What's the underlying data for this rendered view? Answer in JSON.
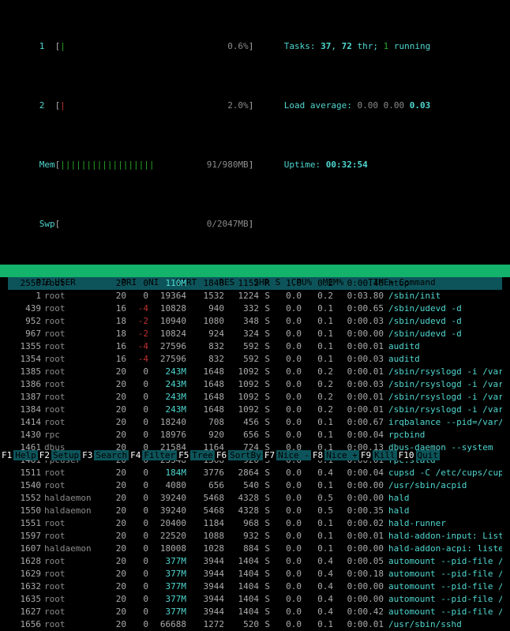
{
  "header": {
    "cpu1": {
      "label": "1",
      "bar": "|",
      "value": "0.6%"
    },
    "cpu2": {
      "label": "2",
      "bar": "|",
      "value": "2.0%"
    },
    "mem": {
      "label": "Mem",
      "bar": "||||||||||||||||||",
      "value": "91/980MB"
    },
    "swp": {
      "label": "Swp",
      "bar": "",
      "value": "0/2047MB"
    },
    "tasks": {
      "prefix": "Tasks: ",
      "total": "37",
      "sep1": ", ",
      "thr": "72",
      "thr_lbl": " thr; ",
      "running": "1",
      "running_lbl": " running"
    },
    "load": {
      "prefix": "Load average: ",
      "v1": "0.00",
      "v2": "0.00",
      "v3": "0.03"
    },
    "uptime": {
      "prefix": "Uptime: ",
      "value": "00:32:54"
    }
  },
  "columns": {
    "pid": "PID",
    "user": "USER",
    "pri": "PRI",
    "ni": "NI",
    "virt": "VIRT",
    "res": "RES",
    "shr": "SHR",
    "s": "S",
    "cpu": "CPU%",
    "mem": "MEM%",
    "time": "TIME+",
    "cmd": "Command"
  },
  "procs": [
    {
      "pid": "2550",
      "user": "root",
      "pri": "20",
      "ni": "0",
      "virt": "110M",
      "res": "1840",
      "shr": "1152",
      "s": "R",
      "cpu": "1.0",
      "mem": "0.2",
      "time": "0:00.46",
      "cmd": "htop",
      "sel": true,
      "virt_big": true
    },
    {
      "pid": "1",
      "user": "root",
      "pri": "20",
      "ni": "0",
      "virt": "19364",
      "res": "1532",
      "shr": "1224",
      "s": "S",
      "cpu": "0.0",
      "mem": "0.2",
      "time": "0:03.80",
      "cmd": "/sbin/init"
    },
    {
      "pid": "439",
      "user": "root",
      "pri": "16",
      "ni": "-4",
      "virt": "10828",
      "res": "940",
      "shr": "332",
      "s": "S",
      "cpu": "0.0",
      "mem": "0.1",
      "time": "0:00.65",
      "cmd": "/sbin/udevd -d",
      "ni_neg": true
    },
    {
      "pid": "952",
      "user": "root",
      "pri": "18",
      "ni": "-2",
      "virt": "10940",
      "res": "1080",
      "shr": "348",
      "s": "S",
      "cpu": "0.0",
      "mem": "0.1",
      "time": "0:00.03",
      "cmd": "/sbin/udevd -d",
      "ni_neg": true
    },
    {
      "pid": "967",
      "user": "root",
      "pri": "18",
      "ni": "-2",
      "virt": "10824",
      "res": "924",
      "shr": "324",
      "s": "S",
      "cpu": "0.0",
      "mem": "0.1",
      "time": "0:00.00",
      "cmd": "/sbin/udevd -d",
      "ni_neg": true
    },
    {
      "pid": "1355",
      "user": "root",
      "pri": "16",
      "ni": "-4",
      "virt": "27596",
      "res": "832",
      "shr": "592",
      "s": "S",
      "cpu": "0.0",
      "mem": "0.1",
      "time": "0:00.01",
      "cmd": "auditd",
      "ni_neg": true
    },
    {
      "pid": "1354",
      "user": "root",
      "pri": "16",
      "ni": "-4",
      "virt": "27596",
      "res": "832",
      "shr": "592",
      "s": "S",
      "cpu": "0.0",
      "mem": "0.1",
      "time": "0:00.03",
      "cmd": "auditd",
      "ni_neg": true
    },
    {
      "pid": "1385",
      "user": "root",
      "pri": "20",
      "ni": "0",
      "virt": "243M",
      "res": "1648",
      "shr": "1092",
      "s": "S",
      "cpu": "0.0",
      "mem": "0.2",
      "time": "0:00.01",
      "cmd": "/sbin/rsyslogd -i /var/run/",
      "virt_big": true
    },
    {
      "pid": "1386",
      "user": "root",
      "pri": "20",
      "ni": "0",
      "virt": "243M",
      "res": "1648",
      "shr": "1092",
      "s": "S",
      "cpu": "0.0",
      "mem": "0.2",
      "time": "0:00.03",
      "cmd": "/sbin/rsyslogd -i /var/run/",
      "virt_big": true
    },
    {
      "pid": "1387",
      "user": "root",
      "pri": "20",
      "ni": "0",
      "virt": "243M",
      "res": "1648",
      "shr": "1092",
      "s": "S",
      "cpu": "0.0",
      "mem": "0.2",
      "time": "0:00.01",
      "cmd": "/sbin/rsyslogd -i /var/run/",
      "virt_big": true
    },
    {
      "pid": "1384",
      "user": "root",
      "pri": "20",
      "ni": "0",
      "virt": "243M",
      "res": "1648",
      "shr": "1092",
      "s": "S",
      "cpu": "0.0",
      "mem": "0.2",
      "time": "0:00.01",
      "cmd": "/sbin/rsyslogd -i /var/run/",
      "virt_big": true
    },
    {
      "pid": "1414",
      "user": "root",
      "pri": "20",
      "ni": "0",
      "virt": "18240",
      "res": "708",
      "shr": "456",
      "s": "S",
      "cpu": "0.0",
      "mem": "0.1",
      "time": "0:00.67",
      "cmd": "irqbalance --pid=/var/run/i"
    },
    {
      "pid": "1430",
      "user": "rpc",
      "pri": "20",
      "ni": "0",
      "virt": "18976",
      "res": "920",
      "shr": "656",
      "s": "S",
      "cpu": "0.0",
      "mem": "0.1",
      "time": "0:00.04",
      "cmd": "rpcbind"
    },
    {
      "pid": "1461",
      "user": "dbus",
      "pri": "20",
      "ni": "0",
      "virt": "21584",
      "res": "1164",
      "shr": "724",
      "s": "S",
      "cpu": "0.0",
      "mem": "0.1",
      "time": "0:00.13",
      "cmd": "dbus-daemon --system"
    },
    {
      "pid": "1481",
      "user": "rpcuser",
      "pri": "20",
      "ni": "0",
      "virt": "23348",
      "res": "1368",
      "shr": "920",
      "s": "S",
      "cpu": "0.0",
      "mem": "0.1",
      "time": "0:00.01",
      "cmd": "rpc.statd"
    },
    {
      "pid": "1511",
      "user": "root",
      "pri": "20",
      "ni": "0",
      "virt": "184M",
      "res": "3776",
      "shr": "2864",
      "s": "S",
      "cpu": "0.0",
      "mem": "0.4",
      "time": "0:00.04",
      "cmd": "cupsd -C /etc/cups/cupsd.co",
      "virt_big": true
    },
    {
      "pid": "1540",
      "user": "root",
      "pri": "20",
      "ni": "0",
      "virt": "4080",
      "res": "656",
      "shr": "540",
      "s": "S",
      "cpu": "0.0",
      "mem": "0.1",
      "time": "0:00.00",
      "cmd": "/usr/sbin/acpid"
    },
    {
      "pid": "1552",
      "user": "haldaemon",
      "pri": "20",
      "ni": "0",
      "virt": "39240",
      "res": "5468",
      "shr": "4328",
      "s": "S",
      "cpu": "0.0",
      "mem": "0.5",
      "time": "0:00.00",
      "cmd": "hald"
    },
    {
      "pid": "1550",
      "user": "haldaemon",
      "pri": "20",
      "ni": "0",
      "virt": "39240",
      "res": "5468",
      "shr": "4328",
      "s": "S",
      "cpu": "0.0",
      "mem": "0.5",
      "time": "0:00.35",
      "cmd": "hald"
    },
    {
      "pid": "1551",
      "user": "root",
      "pri": "20",
      "ni": "0",
      "virt": "20400",
      "res": "1184",
      "shr": "968",
      "s": "S",
      "cpu": "0.0",
      "mem": "0.1",
      "time": "0:00.02",
      "cmd": "hald-runner"
    },
    {
      "pid": "1597",
      "user": "root",
      "pri": "20",
      "ni": "0",
      "virt": "22520",
      "res": "1088",
      "shr": "932",
      "s": "S",
      "cpu": "0.0",
      "mem": "0.1",
      "time": "0:00.01",
      "cmd": "hald-addon-input: Listening"
    },
    {
      "pid": "1607",
      "user": "haldaemon",
      "pri": "20",
      "ni": "0",
      "virt": "18008",
      "res": "1028",
      "shr": "884",
      "s": "S",
      "cpu": "0.0",
      "mem": "0.1",
      "time": "0:00.00",
      "cmd": "hald-addon-acpi: listening"
    },
    {
      "pid": "1628",
      "user": "root",
      "pri": "20",
      "ni": "0",
      "virt": "377M",
      "res": "3944",
      "shr": "1404",
      "s": "S",
      "cpu": "0.0",
      "mem": "0.4",
      "time": "0:00.05",
      "cmd": "automount --pid-file /var/r",
      "virt_big": true
    },
    {
      "pid": "1629",
      "user": "root",
      "pri": "20",
      "ni": "0",
      "virt": "377M",
      "res": "3944",
      "shr": "1404",
      "s": "S",
      "cpu": "0.0",
      "mem": "0.4",
      "time": "0:00.18",
      "cmd": "automount --pid-file /var/r",
      "virt_big": true
    },
    {
      "pid": "1632",
      "user": "root",
      "pri": "20",
      "ni": "0",
      "virt": "377M",
      "res": "3944",
      "shr": "1404",
      "s": "S",
      "cpu": "0.0",
      "mem": "0.4",
      "time": "0:00.00",
      "cmd": "automount --pid-file /var/r",
      "virt_big": true
    },
    {
      "pid": "1635",
      "user": "root",
      "pri": "20",
      "ni": "0",
      "virt": "377M",
      "res": "3944",
      "shr": "1404",
      "s": "S",
      "cpu": "0.0",
      "mem": "0.4",
      "time": "0:00.00",
      "cmd": "automount --pid-file /var/r",
      "virt_big": true
    },
    {
      "pid": "1627",
      "user": "root",
      "pri": "20",
      "ni": "0",
      "virt": "377M",
      "res": "3944",
      "shr": "1404",
      "s": "S",
      "cpu": "0.0",
      "mem": "0.4",
      "time": "0:00.42",
      "cmd": "automount --pid-file /var/r",
      "virt_big": true
    },
    {
      "pid": "1656",
      "user": "root",
      "pri": "20",
      "ni": "0",
      "virt": "66688",
      "res": "1272",
      "shr": "520",
      "s": "S",
      "cpu": "0.0",
      "mem": "0.1",
      "time": "0:00.01",
      "cmd": "/usr/sbin/sshd"
    }
  ],
  "footer": [
    {
      "key": "F1",
      "label": "Help"
    },
    {
      "key": "F2",
      "label": "Setup"
    },
    {
      "key": "F3",
      "label": "Search"
    },
    {
      "key": "F4",
      "label": "Filter"
    },
    {
      "key": "F5",
      "label": "Tree"
    },
    {
      "key": "F6",
      "label": "SortBy"
    },
    {
      "key": "F7",
      "label": "Nice -"
    },
    {
      "key": "F8",
      "label": "Nice +"
    },
    {
      "key": "F9",
      "label": "Kill"
    },
    {
      "key": "F10",
      "label": "Quit"
    }
  ]
}
